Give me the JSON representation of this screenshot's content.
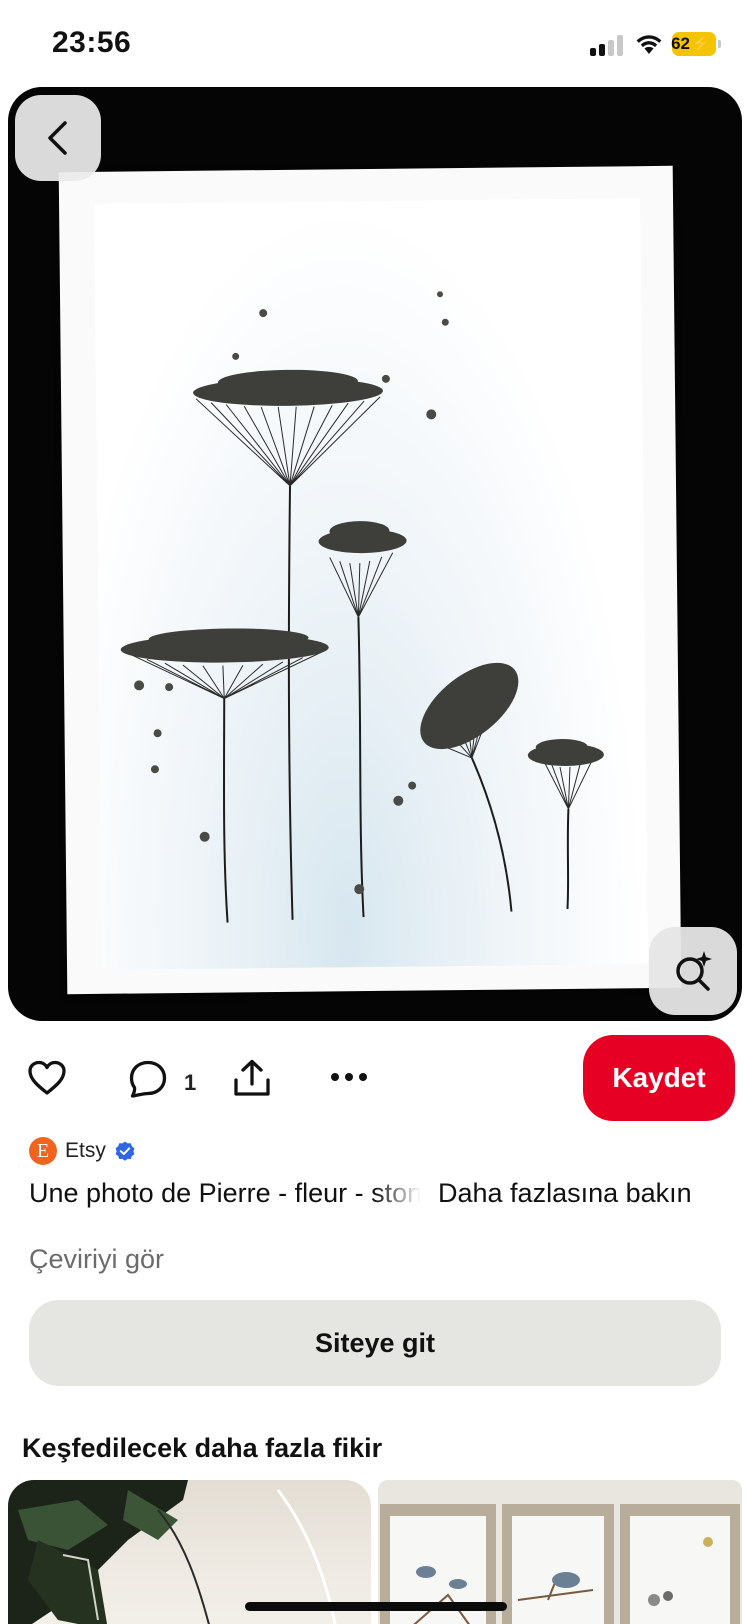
{
  "status_bar": {
    "time": "23:56",
    "battery_level": "62",
    "battery_color": "#f5c400",
    "signal_bars_active": 2,
    "signal_bars_total": 4
  },
  "pin": {
    "back_icon": "chevron-left-icon",
    "visual_search_icon": "visual-search-icon",
    "image_subject": "Pebble art dandelion flowers in white frame"
  },
  "actions": {
    "like_icon": "heart-icon",
    "comment_icon": "comment-icon",
    "comment_count": "1",
    "share_icon": "share-icon",
    "more_icon": "ellipsis-icon",
    "save_label": "Kaydet",
    "save_color": "#e60023"
  },
  "source": {
    "logo_letter": "E",
    "name": "Etsy",
    "verified_icon": "verified-badge-icon"
  },
  "title": "Une photo de Pierre - fleur - stone art",
  "see_more": "Daha fazlasına bakın",
  "translate": "Çeviriyi gör",
  "visit_button": "Siteye git",
  "more_ideas": {
    "heading": "Keşfedilecek daha fazla fikir"
  }
}
